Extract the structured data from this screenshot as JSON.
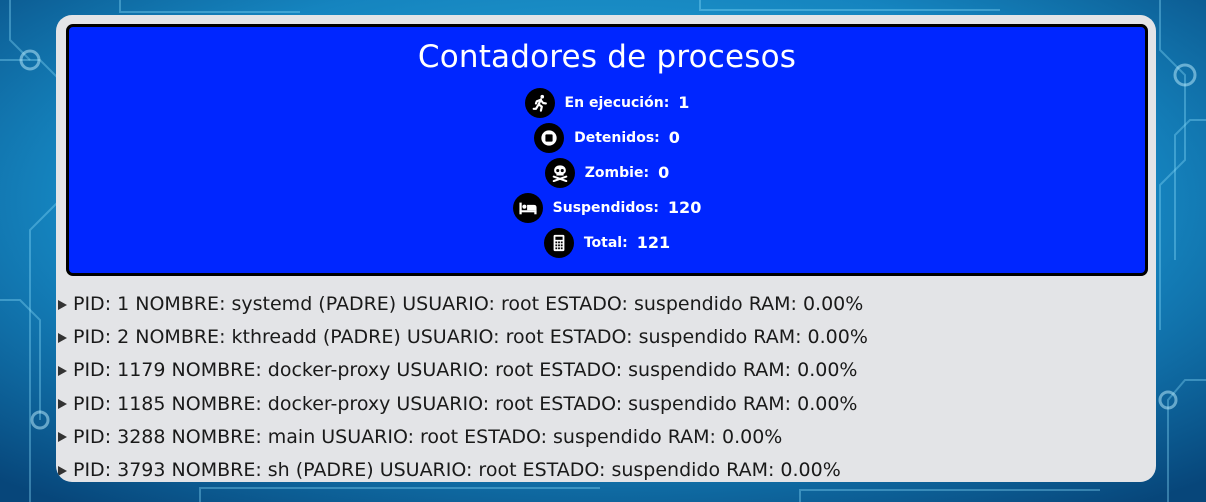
{
  "counters": {
    "title": "Contadores de procesos",
    "items": [
      {
        "icon": "running-person-icon",
        "label": "En ejecución:",
        "value": "1"
      },
      {
        "icon": "stop-icon",
        "label": "Detenidos:",
        "value": "0"
      },
      {
        "icon": "skull-crossbones-icon",
        "label": "Zombie:",
        "value": "0"
      },
      {
        "icon": "bed-icon",
        "label": "Suspendidos:",
        "value": "120"
      },
      {
        "icon": "calculator-icon",
        "label": "Total:",
        "value": "121"
      }
    ]
  },
  "processes": [
    "PID: 1 NOMBRE: systemd (PADRE) USUARIO: root ESTADO: suspendido RAM: 0.00%",
    "PID: 2 NOMBRE: kthreadd (PADRE) USUARIO: root ESTADO: suspendido RAM: 0.00%",
    "PID: 1179 NOMBRE: docker-proxy USUARIO: root ESTADO: suspendido RAM: 0.00%",
    "PID: 1185 NOMBRE: docker-proxy USUARIO: root ESTADO: suspendido RAM: 0.00%",
    "PID: 3288 NOMBRE: main USUARIO: root ESTADO: suspendido RAM: 0.00%",
    "PID: 3793 NOMBRE: sh (PADRE) USUARIO: root ESTADO: suspendido RAM: 0.00%"
  ],
  "colors": {
    "counters_bg": "#0026ff",
    "panel_bg": "#e3e4e7",
    "page_bg": "#0a5a8c"
  }
}
